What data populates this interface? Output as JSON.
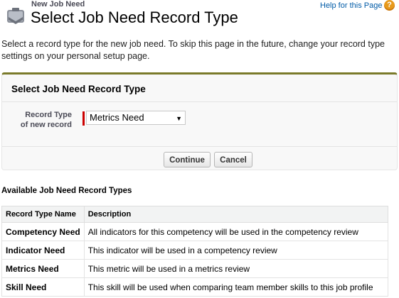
{
  "header": {
    "eyebrow": "New Job Need",
    "title": "Select Job Need Record Type",
    "help_link": "Help for this Page",
    "help_icon": "question-icon"
  },
  "intro_text": "Select a record type for the new job need. To skip this page in the future, change your record type settings on your personal setup page.",
  "panel": {
    "title": "Select Job Need Record Type",
    "field_label_line1": "Record Type",
    "field_label_line2": "of new record",
    "selected_record_type": "Metrics Need",
    "continue_label": "Continue",
    "cancel_label": "Cancel"
  },
  "available": {
    "heading": "Available Job Need Record Types",
    "columns": [
      "Record Type Name",
      "Description"
    ],
    "rows": [
      {
        "name": "Competency Need",
        "description": "All indicators for this competency will be used in the competency review"
      },
      {
        "name": "Indicator Need",
        "description": "This indicator will be used in a competency review"
      },
      {
        "name": "Metrics Need",
        "description": "This metric will be used in a metrics review"
      },
      {
        "name": "Skill Need",
        "description": "This skill will be used when comparing team member skills to this job profile"
      }
    ]
  },
  "colors": {
    "accent_bar": "#7a7a2a",
    "link": "#015ba7",
    "required": "#cc0000",
    "help_icon": "#e79a1d"
  }
}
